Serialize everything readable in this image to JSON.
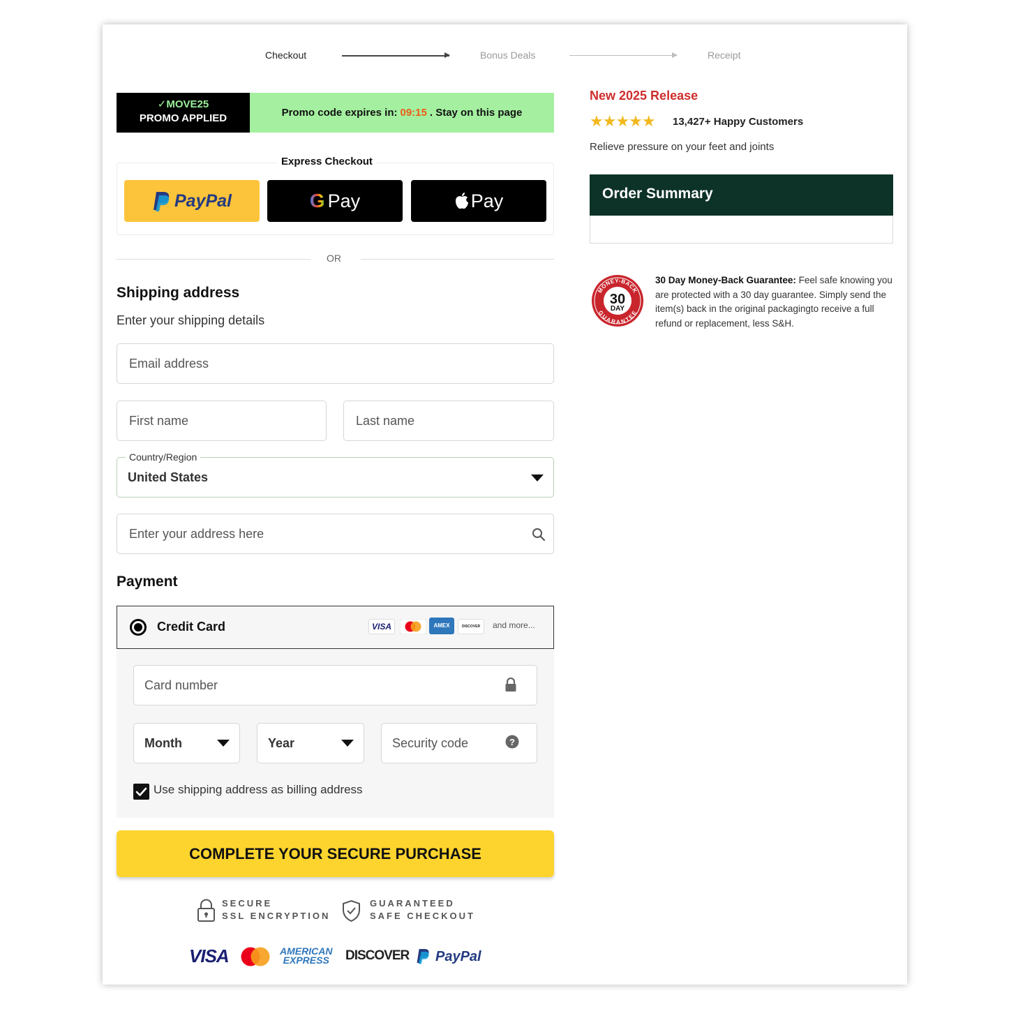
{
  "steps": [
    {
      "label": "Checkout",
      "active": true
    },
    {
      "label": "Bonus Deals",
      "active": false
    },
    {
      "label": "Receipt",
      "active": false
    }
  ],
  "promo": {
    "check": "✓",
    "code": "MOVE25",
    "applied": "PROMO APPLIED",
    "expires_label": "Promo code expires in:",
    "timer": "09:15",
    "stay": ". Stay on this page"
  },
  "express": {
    "title": "Express Checkout",
    "paypal": "PayPal",
    "gpay_g": "G",
    "gpay": "Pay",
    "applepay": "Pay",
    "or": "OR"
  },
  "shipping": {
    "title": "Shipping address",
    "subtitle": "Enter your shipping details",
    "email_placeholder": "Email address",
    "first_name_placeholder": "First name",
    "last_name_placeholder": "Last name",
    "country_label": "Country/Region",
    "country_value": "United States",
    "address_placeholder": "Enter your address here"
  },
  "payment": {
    "title": "Payment",
    "method": "Credit Card",
    "card_logos": [
      "VISA",
      "AMEX",
      "DISCOVER"
    ],
    "and_more": "and more...",
    "card_number_placeholder": "Card number",
    "month": "Month",
    "year": "Year",
    "security_placeholder": "Security code",
    "billing_checkbox_label": "Use shipping address as billing address",
    "billing_checked": true
  },
  "cta": "COMPLETE YOUR SECURE PURCHASE",
  "trust": {
    "secure_line1": "SECURE",
    "secure_line2": "SSL ENCRYPTION",
    "guaranteed_line1": "GUARANTEED",
    "guaranteed_line2": "SAFE CHECKOUT"
  },
  "footer_logos": {
    "visa": "VISA",
    "amex_line1": "AMERICAN",
    "amex_line2": "EXPRESS",
    "discover": "DISCOVER",
    "paypal": "PayPal"
  },
  "product": {
    "release": "New 2025 Release",
    "stars": "★★★★★",
    "customers": "13,427+ Happy Customers",
    "tagline": "Relieve pressure on your feet and joints"
  },
  "order_summary": {
    "title": "Order Summary"
  },
  "guarantee": {
    "badge_top": "MONEY-BACK",
    "badge_num": "30",
    "badge_day": "DAY",
    "badge_bottom": "GUARANTEE",
    "title": "30 Day Money-Back Guarantee:",
    "text": " Feel safe knowing you are protected with a 30 day guarantee. Simply send the item(s) back in the original packagingto receive a full refund or replacement, less S&H."
  },
  "colors": {
    "promo_green": "#a4f0a0",
    "timer": "#f05a18",
    "paypal_yellow": "#fcc43a",
    "cta_yellow": "#fdd42e",
    "order_summary_bg": "#0d3227",
    "release_red": "#cf2d2d",
    "star": "#f2b81d"
  }
}
